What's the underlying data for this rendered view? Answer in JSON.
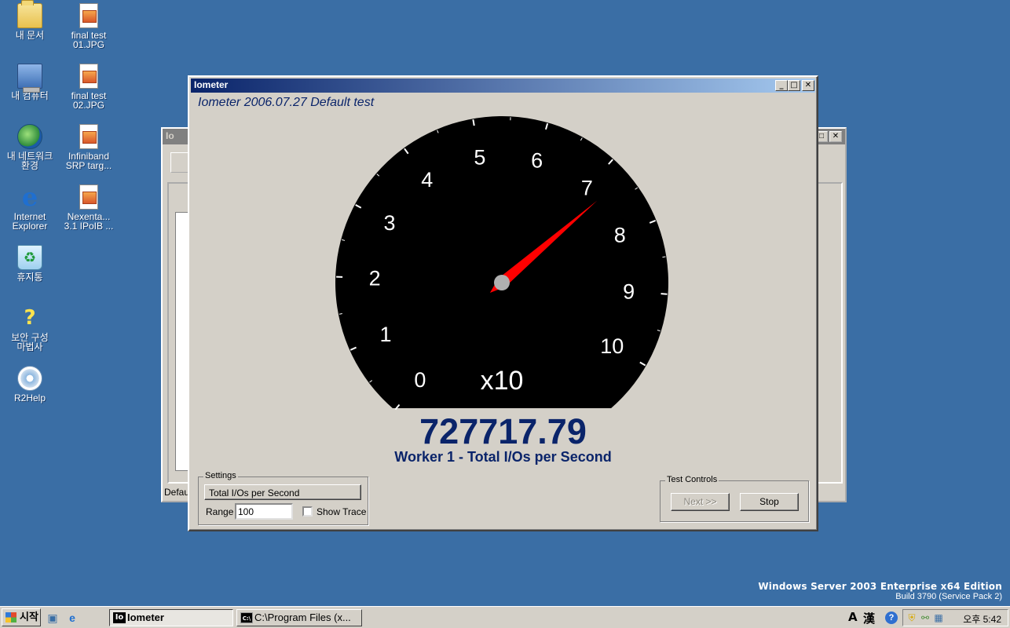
{
  "desktop": {
    "icons": [
      {
        "label": "내 문서",
        "icon": "folder-icon"
      },
      {
        "label": "내 컴퓨터",
        "icon": "computer-icon"
      },
      {
        "label": "내 네트워크\n환경",
        "icon": "network-icon"
      },
      {
        "label": "Internet\nExplorer",
        "icon": "ie-icon"
      },
      {
        "label": "휴지통",
        "icon": "recycle-bin-icon"
      },
      {
        "label": "보안 구성\n마법사",
        "icon": "security-wizard-icon"
      },
      {
        "label": "R2Help",
        "icon": "help-icon"
      },
      {
        "label": "final test\n01.JPG",
        "icon": "jpg-file-icon"
      },
      {
        "label": "final test\n02.JPG",
        "icon": "jpg-file-icon"
      },
      {
        "label": "Infiniband\nSRP targ...",
        "icon": "jpg-file-icon"
      },
      {
        "label": "Nexenta...\n3.1 IPoIB ...",
        "icon": "jpg-file-icon"
      }
    ],
    "watermark": {
      "line1": "Windows Server 2003 Enterprise x64 Edition",
      "line2": "Build 3790 (Service Pack 2)"
    }
  },
  "background_window": {
    "title_fragment": "Io",
    "status_fragment": "Defau"
  },
  "meter_window": {
    "title": "Iometer",
    "subtitle": "Iometer 2006.07.27 Default test",
    "gauge": {
      "tick_labels": [
        "0",
        "1",
        "2",
        "3",
        "4",
        "5",
        "6",
        "7",
        "8",
        "9",
        "10"
      ],
      "multiplier": "x10",
      "needle_value": 72.8,
      "range": 100,
      "colors": {
        "face": "#000000",
        "needle": "#ff0000",
        "text": "#ffffff"
      }
    },
    "readout": "727717.79",
    "caption": "Worker 1 - Total I/Os per Second",
    "settings": {
      "group_label": "Settings",
      "metric_button": "Total I/Os per Second",
      "range_label": "Range",
      "range_value": "100",
      "show_trace_label": "Show Trace",
      "show_trace_checked": false
    },
    "test_controls": {
      "group_label": "Test Controls",
      "next_label": "Next >>",
      "stop_label": "Stop"
    }
  },
  "taskbar": {
    "start_label": "시작",
    "tasks": [
      {
        "label": "Iometer",
        "active": true
      },
      {
        "label": "C:\\Program Files (x...",
        "active": false
      }
    ],
    "ime": {
      "mode": "A",
      "hanja": "漢"
    },
    "clock": "오후 5:42"
  }
}
